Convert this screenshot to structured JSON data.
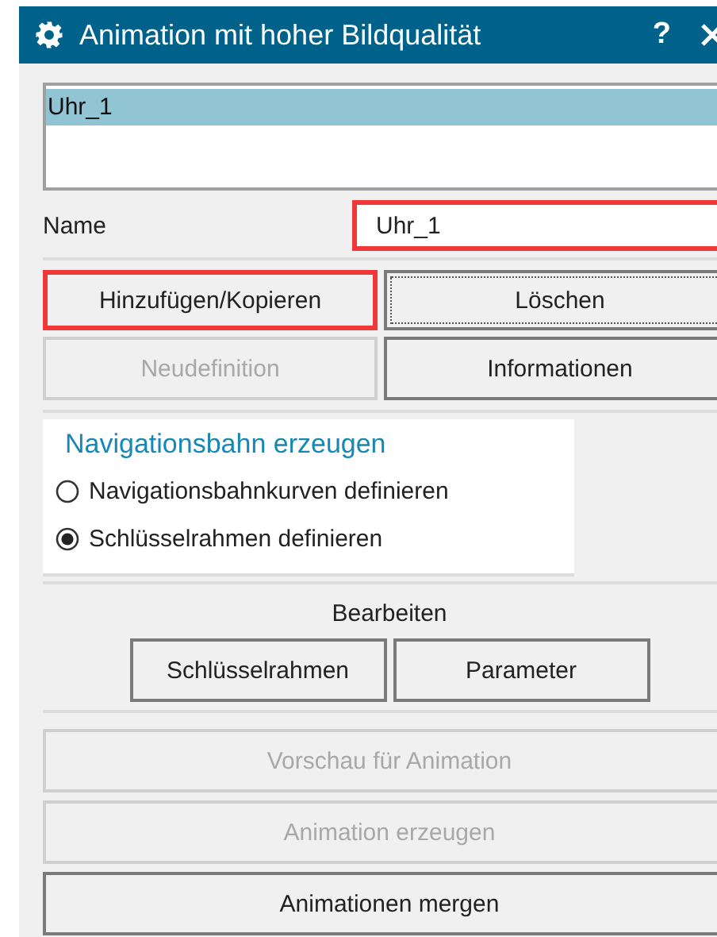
{
  "window": {
    "title": "Animation mit hoher Bildqualität",
    "help": "?"
  },
  "list": {
    "items": [
      {
        "label": "Uhr_1",
        "selected": true
      }
    ]
  },
  "name_field": {
    "label": "Name",
    "value": "Uhr_1",
    "highlighted": true
  },
  "actions": [
    {
      "label": "Hinzufügen/Kopieren",
      "disabled": false,
      "highlighted": true,
      "focused": false
    },
    {
      "label": "Löschen",
      "disabled": false,
      "highlighted": false,
      "focused": true
    },
    {
      "label": "Neudefinition",
      "disabled": true,
      "highlighted": false,
      "focused": false
    },
    {
      "label": "Informationen",
      "disabled": false,
      "highlighted": false,
      "focused": false
    }
  ],
  "path_group": {
    "title": "Navigationsbahn erzeugen",
    "options": [
      {
        "label": "Navigationsbahnkurven definieren",
        "selected": false
      },
      {
        "label": "Schlüsselrahmen definieren",
        "selected": true
      }
    ]
  },
  "edit_section": {
    "title": "Bearbeiten",
    "buttons": [
      {
        "label": "Schlüsselrahmen",
        "disabled": false
      },
      {
        "label": "Parameter",
        "disabled": false
      }
    ]
  },
  "bottom_buttons": [
    {
      "label": "Vorschau für Animation",
      "disabled": true
    },
    {
      "label": "Animation erzeugen",
      "disabled": true
    },
    {
      "label": "Animationen mergen",
      "disabled": false
    }
  ]
}
